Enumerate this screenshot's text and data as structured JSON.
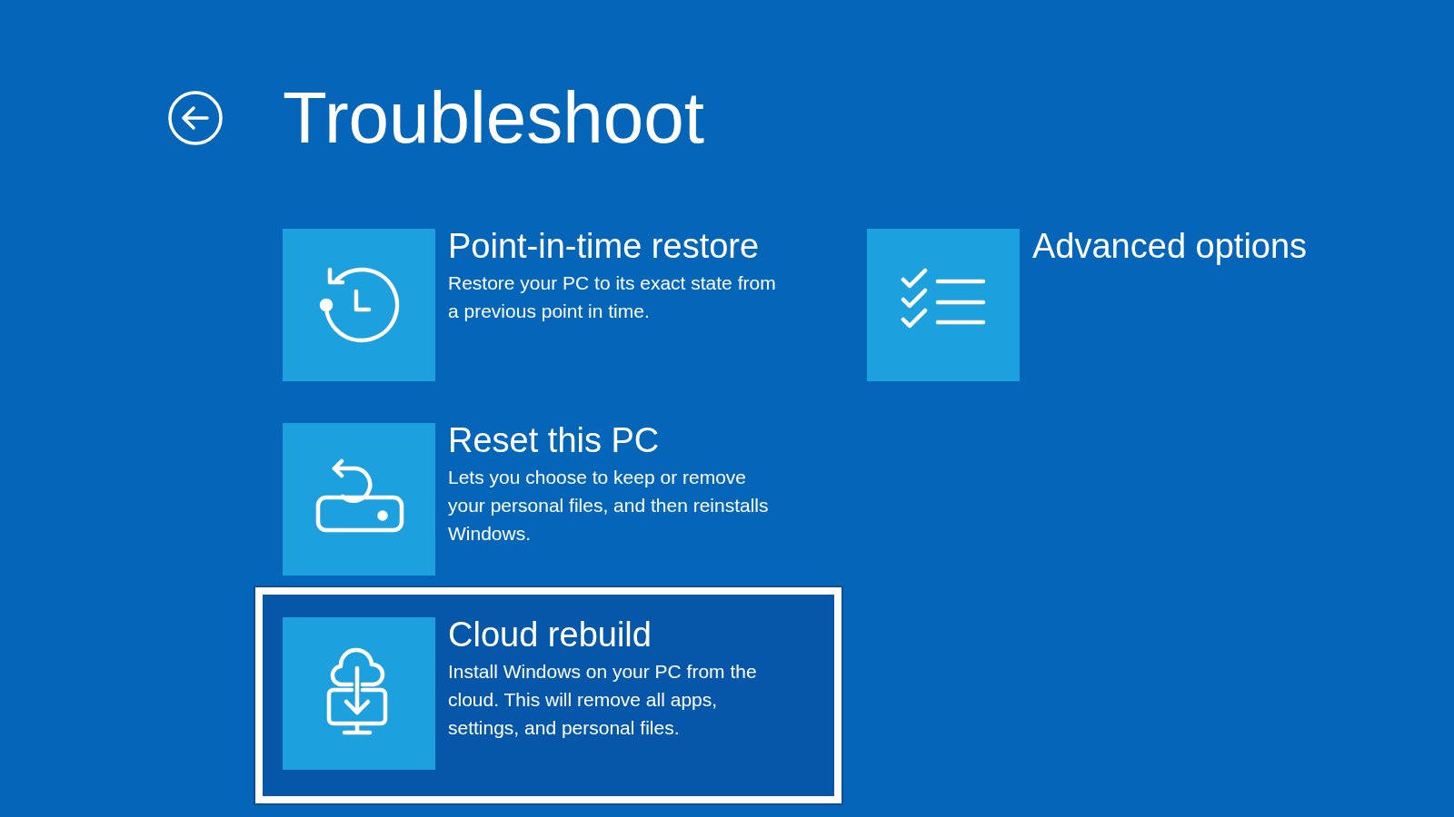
{
  "header": {
    "title": "Troubleshoot"
  },
  "columns": [
    {
      "options": [
        {
          "kind": "clock",
          "title": "Point-in-time restore",
          "description": "Restore your PC to its exact state from a previous point in time.",
          "selected": false
        },
        {
          "kind": "drive",
          "title": "Reset this PC",
          "description": "Lets you choose to keep or remove your personal files, and then reinstalls Windows.",
          "selected": false
        },
        {
          "kind": "cloud",
          "title": "Cloud rebuild",
          "description": "Install Windows on your PC from the cloud. This will remove all apps, settings, and personal files.",
          "selected": true
        }
      ]
    },
    {
      "options": [
        {
          "kind": "checklist",
          "title": "Advanced options",
          "selected": false
        }
      ]
    }
  ]
}
